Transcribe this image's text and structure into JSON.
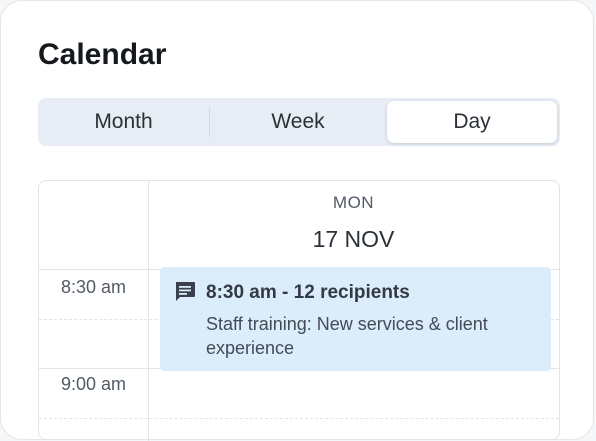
{
  "header": {
    "title": "Calendar"
  },
  "view_switcher": {
    "options": [
      "Month",
      "Week",
      "Day"
    ],
    "selected": "Day"
  },
  "day_column": {
    "weekday": "MON",
    "date": "17 NOV"
  },
  "time_slots": [
    "8:30 am",
    "9:00 am"
  ],
  "event": {
    "title": "8:30 am - 12 recipients",
    "description": "Staff training: New services & client experience",
    "icon": "message-icon"
  }
}
